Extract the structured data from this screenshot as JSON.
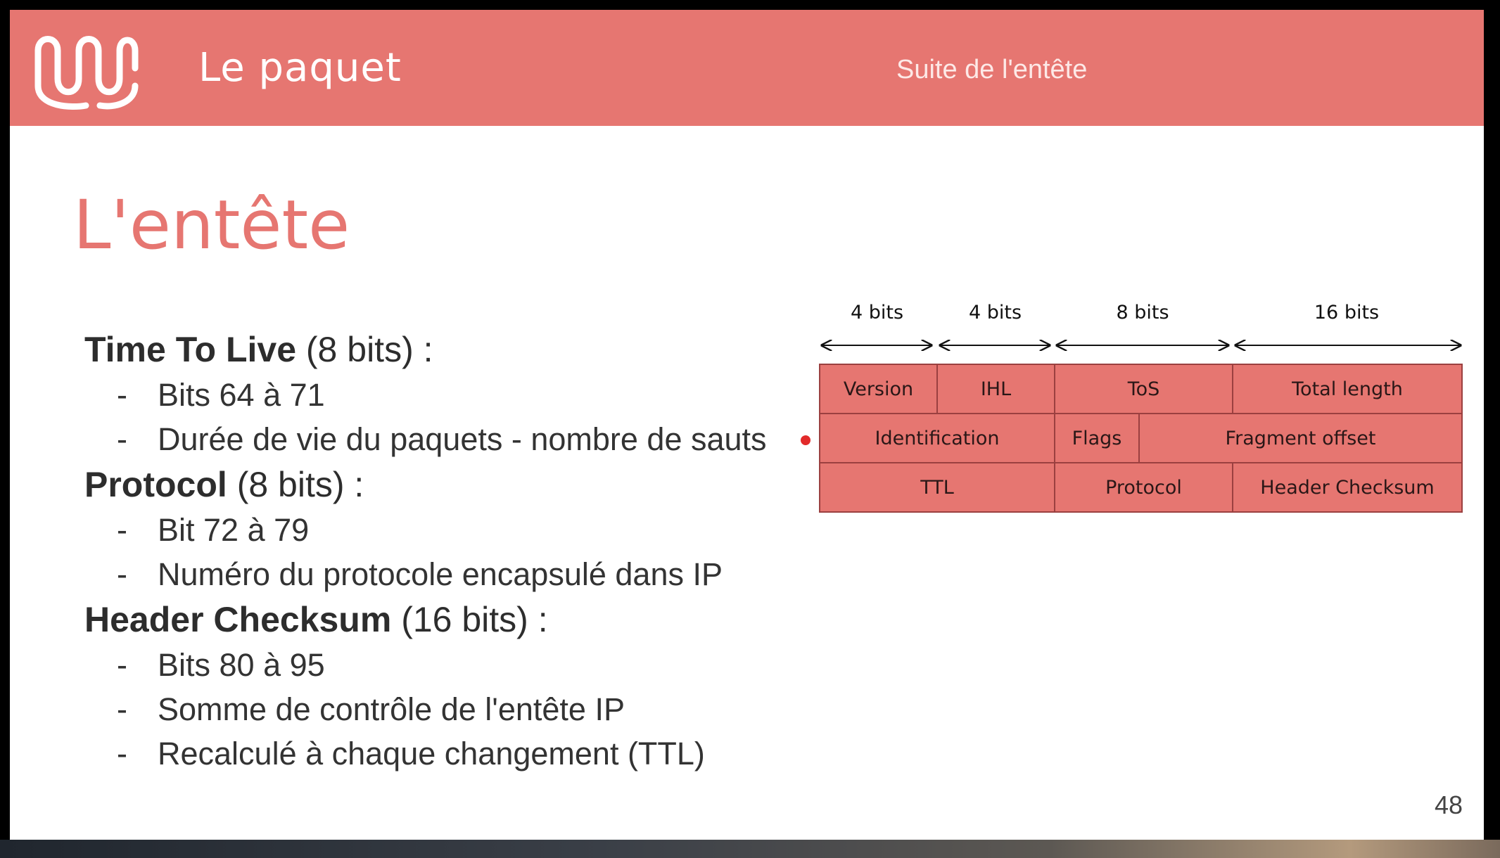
{
  "header": {
    "title": "Le paquet",
    "subtitle": "Suite de l'entête",
    "accent_color": "#e67671",
    "logo_icon": "wave-logo-icon"
  },
  "slide_title": "L'entête",
  "sections": [
    {
      "name": "Time To Live",
      "suffix": " (8 bits) :",
      "bullets": [
        "Bits 64 à 71",
        "Durée de vie du paquets - nombre de sauts"
      ]
    },
    {
      "name": "Protocol",
      "suffix": " (8 bits) :",
      "bullets": [
        "Bit 72 à 79",
        "Numéro du protocole encapsulé dans IP"
      ]
    },
    {
      "name": "Header Checksum",
      "suffix": " (16 bits) :",
      "bullets": [
        "Bits 80 à 95",
        "Somme de contrôle de l'entête IP",
        "Recalculé à chaque changement (TTL)"
      ]
    }
  ],
  "bullet_dash": "-",
  "diagram": {
    "bit_labels": [
      "4 bits",
      "4 bits",
      "8 bits",
      "16 bits"
    ],
    "rows": [
      [
        "Version",
        "IHL",
        "ToS",
        "Total length"
      ],
      [
        "Identification",
        "Flags",
        "Fragment offset"
      ],
      [
        "TTL",
        "Protocol",
        "Header Checksum"
      ]
    ]
  },
  "page_number": "48"
}
